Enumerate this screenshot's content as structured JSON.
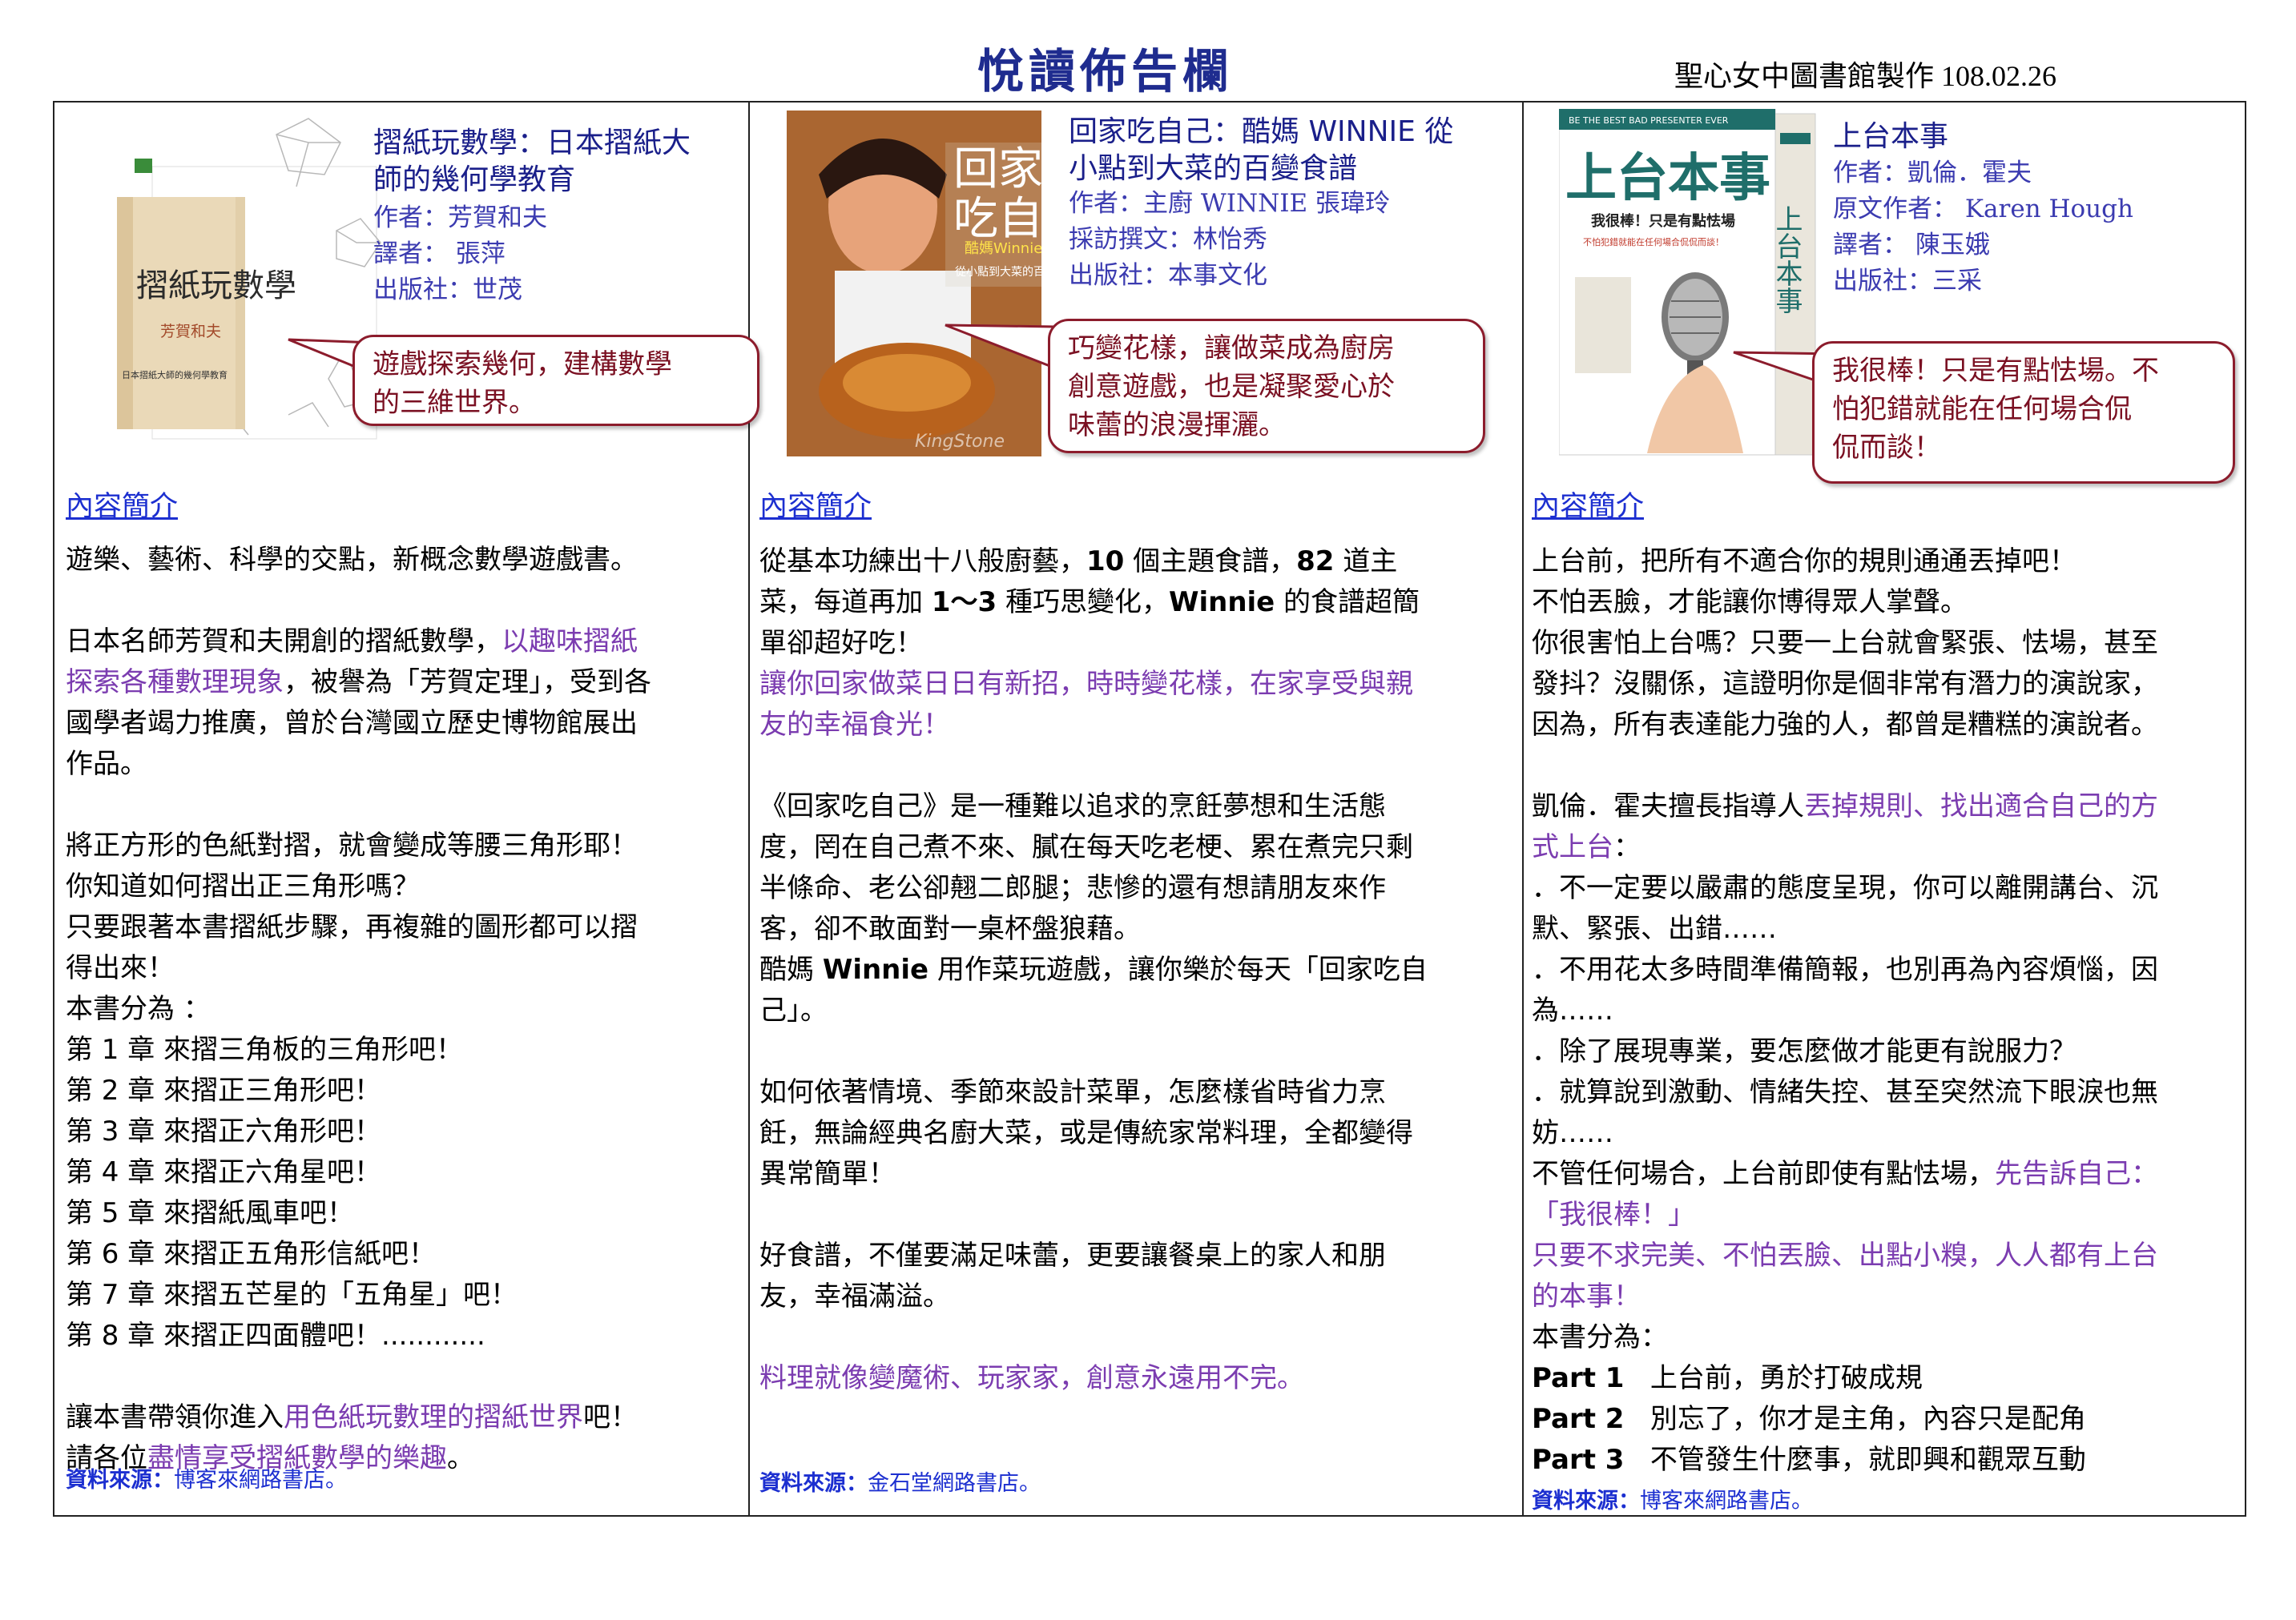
{
  "header": {
    "title": "悅讀佈告欄",
    "credit": "聖心女中圖書館製作 108.02.26"
  },
  "books": [
    {
      "title_line1": "摺紙玩數學：日本摺紙大",
      "title_line2": "師的幾何學教育",
      "meta": [
        "作者：芳賀和夫",
        "譯者： 張萍",
        "出版社：世茂"
      ],
      "cover": {
        "title": "摺紙玩數學",
        "author": "芳賀和夫",
        "subtitle": "日本摺紙大師的幾何學教育"
      },
      "bubble_line1": "遊戲探索幾何，建構數學",
      "bubble_line2": "的三維世界。",
      "intro_label": "內容簡介",
      "body": {
        "p1": "遊樂、藝術、科學的交點，新概念數學遊戲書。",
        "p2a": "日本名師芳賀和夫開創的摺紙數學，",
        "p2b": "以趣味摺紙",
        "p2c": "探索各種數理現象",
        "p2d": "，被譽為「芳賀定理」，受到各",
        "p2e": "國學者竭力推廣，曾於台灣國立歷史博物館展出",
        "p2f": "作品。",
        "p3a": "將正方形的色紙對摺，就會變成等腰三角形耶！",
        "p3b": "你知道如何摺出正三角形嗎？",
        "p3c": "只要跟著本書摺紙步驟，再複雜的圖形都可以摺",
        "p3d": "得出來！",
        "p3e": "本書分為 ：",
        "chapters": [
          "第 1 章  來摺三角板的三角形吧！",
          "第 2 章  來摺正三角形吧！",
          "第 3 章  來摺正六角形吧！",
          "第 4 章  來摺正六角星吧！",
          "第 5 章  來摺紙風車吧！",
          "第 6 章  來摺正五角形信紙吧！",
          "第 7 章  來摺五芒星的「五角星」吧！",
          "第 8 章  來摺正四面體吧！............"
        ],
        "p4a": "讓本書帶領你進入",
        "p4b": "用色紙玩數理的摺紙世界",
        "p4c": "吧！",
        "p4d": "請各位",
        "p4e": "盡情享受摺紙數學的樂趣",
        "p4f": "。"
      },
      "source_label": "資料來源：",
      "source": "博客來網路書店。"
    },
    {
      "title_line1": "回家吃自己：酷媽 WINNIE 從",
      "title_line2": "小點到大菜的百變食譜",
      "meta": [
        "作者：主廚 WINNIE 張瑋玲",
        "採訪撰文：林怡秀",
        "出版社：本事文化"
      ],
      "cover": {
        "title": "回家吃自己",
        "tag": "酷媽Winnie",
        "subtitle": "從小點到大菜的百變食譜",
        "watermark": "KingStone"
      },
      "bubble_line1": "巧變花樣，讓做菜成為廚房",
      "bubble_line2": "創意遊戲，也是凝聚愛心於",
      "bubble_line3": "味蕾的浪漫揮灑。",
      "intro_label": "內容簡介",
      "body": {
        "l1a": "從基本功練出十八般廚藝，",
        "l1b": "10",
        "l1c": " 個主題食譜，",
        "l1d": "82",
        "l1e": " 道主",
        "l2a": "菜，每道再加 ",
        "l2b": "1～3",
        "l2c": " 種巧思變化，",
        "l2d": "Winnie",
        "l2e": " 的食譜超簡",
        "l3": "單卻超好吃！",
        "l4": "讓你回家做菜日日有新招，時時變花樣，在家享受與親",
        "l5": "友的幸福食光！",
        "p2a": "《回家吃自己》是一種難以追求的烹飪夢想和生活態",
        "p2b": "度，罔在自己煮不來、膩在每天吃老梗、累在煮完只剩",
        "p2c": "半條命、老公卻翹二郎腿；悲慘的還有想請朋友來作",
        "p2d": "客，卻不敢面對一桌杯盤狼藉。",
        "p2e1": "酷媽 ",
        "p2e2": "Winnie",
        "p2e3": " 用作菜玩遊戲，讓你樂於每天「回家吃自",
        "p2f": "己」。",
        "p3a": "如何依著情境、季節來設計菜單，怎麼樣省時省力烹",
        "p3b": "飪，無論經典名廚大菜，或是傳統家常料理，全都變得",
        "p3c": "異常簡單！",
        "p4a": "好食譜，不僅要滿足味蕾，更要讓餐桌上的家人和朋",
        "p4b": "友，幸福滿溢。",
        "p5": "料理就像變魔術、玩家家，創意永遠用不完。"
      },
      "source_label": "資料來源：",
      "source": "金石堂網路書店。"
    },
    {
      "title_line1": "上台本事",
      "meta": [
        "作者：凱倫．霍夫",
        "原文作者： Karen Hough",
        "譯者： 陳玉娥",
        "出版社：三采"
      ],
      "cover": {
        "banner": "BE THE BEST BAD PRESENTER EVER",
        "title": "上台本事",
        "tagline": "我很棒！只是有點怯場",
        "subtitle": "不怕犯錯就能在任何場合侃侃而談！"
      },
      "bubble_line1": "我很棒！只是有點怯場。不",
      "bubble_line2": "怕犯錯就能在任何場合侃",
      "bubble_line3": "侃而談！",
      "intro_label": "內容簡介",
      "body": {
        "l1": "上台前，把所有不適合你的規則通通丟掉吧！",
        "l2": "不怕丟臉，才能讓你博得眾人掌聲。",
        "l3": "你很害怕上台嗎？只要一上台就會緊張、怯場，甚至",
        "l4": "發抖？沒關係，這證明你是個非常有潛力的演說家，",
        "l5": "因為，所有表達能力強的人，都曾是糟糕的演說者。",
        "p2a": "凱倫．霍夫擅長指導人",
        "p2b": "丟掉規則、找出適合自己的方",
        "p2c": "式上台",
        "p2d": "：",
        "p2e": "．不一定要以嚴肅的態度呈現，你可以離開講台、沉",
        "p2f": "默、緊張、出錯……",
        "p2g": "．不用花太多時間準備簡報，也別再為內容煩惱，因",
        "p2h": "為……",
        "p2i": "．除了展現專業，要怎麼做才能更有說服力？",
        "p2j": "．就算說到激動、情緒失控、甚至突然流下眼淚也無",
        "p2k": "妨……",
        "p2l": "不管任何場合，上台前即使有點怯場，",
        "p2m": "先告訴自己：",
        "p2n": "「我很棒！」",
        "p2o": "只要不求完美、不怕丟臉、出點小糗，人人都有上台",
        "p2p": "的本事！",
        "p2q": "本書分為：",
        "parts": [
          {
            "label": "Part 1",
            "text": "上台前，勇於打破成規"
          },
          {
            "label": "Part 2",
            "text": "別忘了，你才是主角，內容只是配角"
          },
          {
            "label": "Part 3",
            "text": "不管發生什麼事，就即興和觀眾互動"
          }
        ]
      },
      "source_label": "資料來源：",
      "source": "博客來網路書店。"
    }
  ],
  "colors": {
    "title": "#1f2c8f",
    "bubble_border": "#8c1c2c",
    "bubble_text": "#7a1022",
    "highlight": "#7b3cb0",
    "link": "#1c2fd0"
  }
}
